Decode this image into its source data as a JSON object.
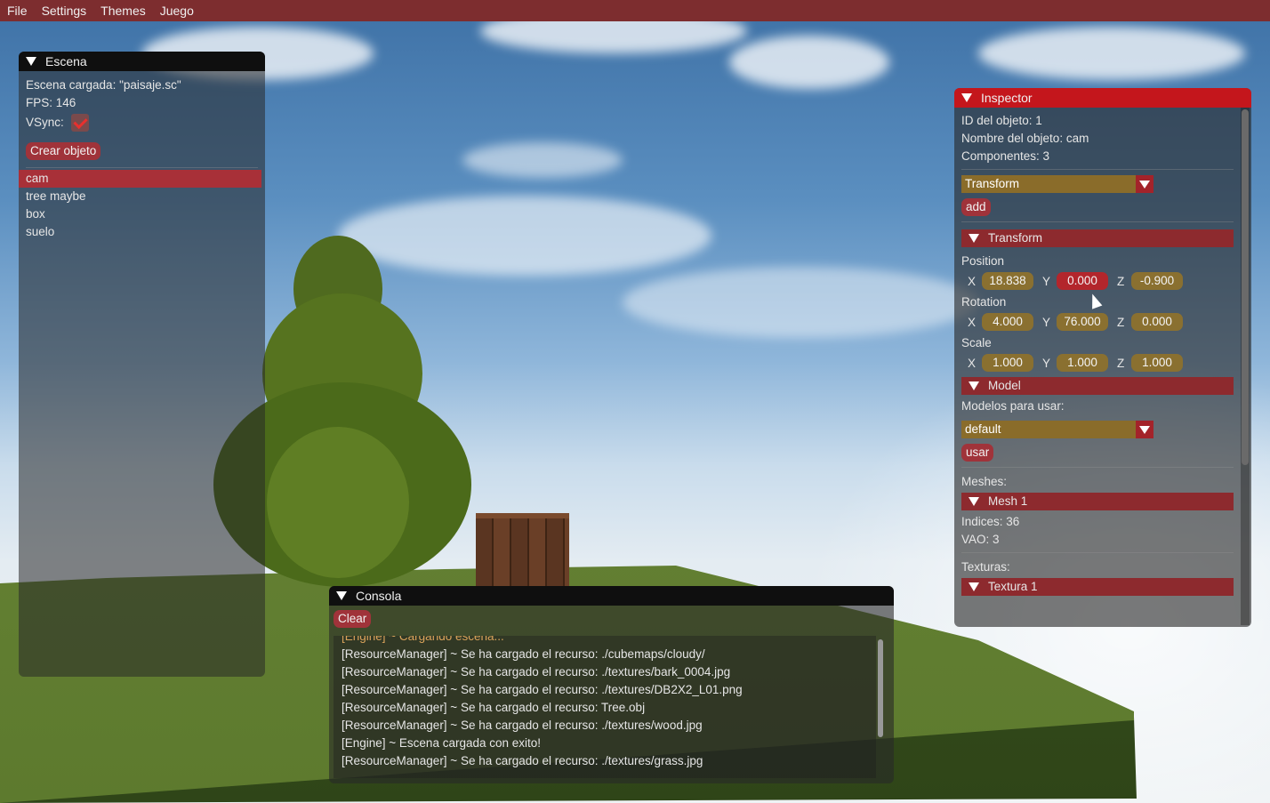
{
  "menubar": {
    "items": [
      "File",
      "Settings",
      "Themes",
      "Juego"
    ]
  },
  "escena": {
    "title": "Escena",
    "loaded": "Escena cargada: \"paisaje.sc\"",
    "fps": "FPS: 146",
    "vsync_label": "VSync:",
    "vsync_checked": true,
    "create_button": "Crear objeto",
    "objects": [
      "cam",
      "tree maybe",
      "box",
      "suelo"
    ],
    "selected": "cam"
  },
  "inspector": {
    "title": "Inspector",
    "object_id": "ID del objeto: 1",
    "object_name": "Nombre del objeto: cam",
    "components": "Componentes: 3",
    "component_combo": "Transform",
    "add_button": "add",
    "transform_header": "Transform",
    "position_label": "Position",
    "rotation_label": "Rotation",
    "scale_label": "Scale",
    "axis": {
      "x": "X",
      "y": "Y",
      "z": "Z"
    },
    "position": {
      "x": "18.838",
      "y": "0.000",
      "z": "-0.900"
    },
    "rotation": {
      "x": "4.000",
      "y": "76.000",
      "z": "0.000"
    },
    "scale": {
      "x": "1.000",
      "y": "1.000",
      "z": "1.000"
    },
    "model_header": "Model",
    "models_label": "Modelos para usar:",
    "model_combo": "default",
    "use_button": "usar",
    "meshes_label": "Meshes:",
    "mesh_header": "Mesh 1",
    "indices": "Indices: 36",
    "vao": "VAO: 3",
    "textures_label": "Texturas:",
    "texture_header": "Textura 1"
  },
  "consola": {
    "title": "Consola",
    "clear_button": "Clear",
    "partial_line": "[Engine] ~ Cargando escena...",
    "lines": [
      "[ResourceManager] ~ Se ha cargado el recurso: ./cubemaps/cloudy/",
      "[ResourceManager] ~ Se ha cargado el recurso: ./textures/bark_0004.jpg",
      "[ResourceManager] ~ Se ha cargado el recurso: ./textures/DB2X2_L01.png",
      "[ResourceManager] ~ Se ha cargado el recurso: Tree.obj",
      "[ResourceManager] ~ Se ha cargado el recurso: ./textures/wood.jpg",
      "[Engine] ~ Escena cargada con exito!",
      "[ResourceManager] ~ Se ha cargado el recurso: ./textures/grass.jpg"
    ]
  },
  "colors": {
    "menubar": "#7d2d2f",
    "accent": "#a0333a",
    "inspector_title": "#c4161c",
    "field": "#8a7030"
  }
}
